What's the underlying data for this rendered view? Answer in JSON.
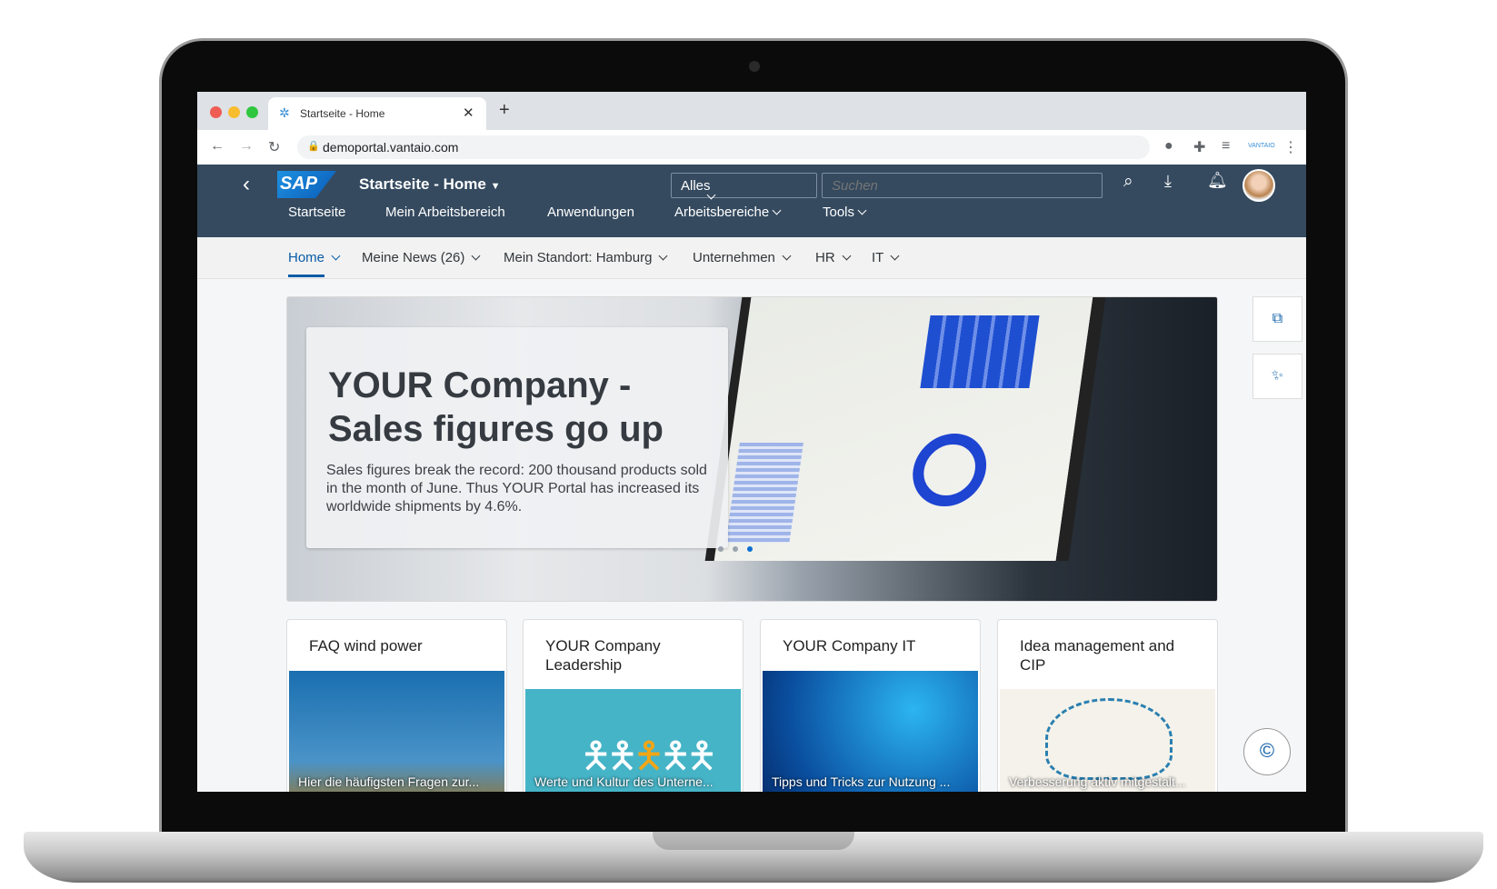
{
  "browser": {
    "tab_title": "Startseite - Home",
    "url": "demoportal.vantaio.com",
    "profile_label": "VANTAIO"
  },
  "shell": {
    "logo": "SAP",
    "title": "Startseite - Home",
    "scope_select": "Alles",
    "search_placeholder": "Suchen",
    "brand_color": "#354a5f",
    "accent_color": "#0a6ed1"
  },
  "nav": [
    {
      "label": "Startseite"
    },
    {
      "label": "Mein Arbeitsbereich"
    },
    {
      "label": "Anwendungen"
    },
    {
      "label": "Arbeitsbereiche"
    },
    {
      "label": "Tools"
    }
  ],
  "subnav": [
    {
      "label": "Home",
      "active": true
    },
    {
      "label": "Meine News (26)"
    },
    {
      "label": "Mein Standort: Hamburg"
    },
    {
      "label": "Unternehmen"
    },
    {
      "label": "HR"
    },
    {
      "label": "IT"
    }
  ],
  "hero": {
    "title": "YOUR Company - Sales figures go up",
    "text": "Sales figures break the record: 200 thousand products sold in the month of June. Thus YOUR Portal has increased its worldwide shipments by 4.6%.",
    "slides": 3,
    "active_slide": 3
  },
  "cards": [
    {
      "title": "FAQ wind power",
      "caption": "Hier die häufigsten Fragen zur..."
    },
    {
      "title": "YOUR Company Leadership",
      "caption": "Werte und Kultur des Unterne..."
    },
    {
      "title": "YOUR Company IT",
      "caption": "Tipps und Tricks zur Nutzung ..."
    },
    {
      "title": "Idea management and CIP",
      "caption": "Verbesserung aktiv mitgestalt..."
    }
  ],
  "side_buttons": [
    "sitemap-icon",
    "magic-wand-icon"
  ],
  "floating_button": "copilot-icon"
}
